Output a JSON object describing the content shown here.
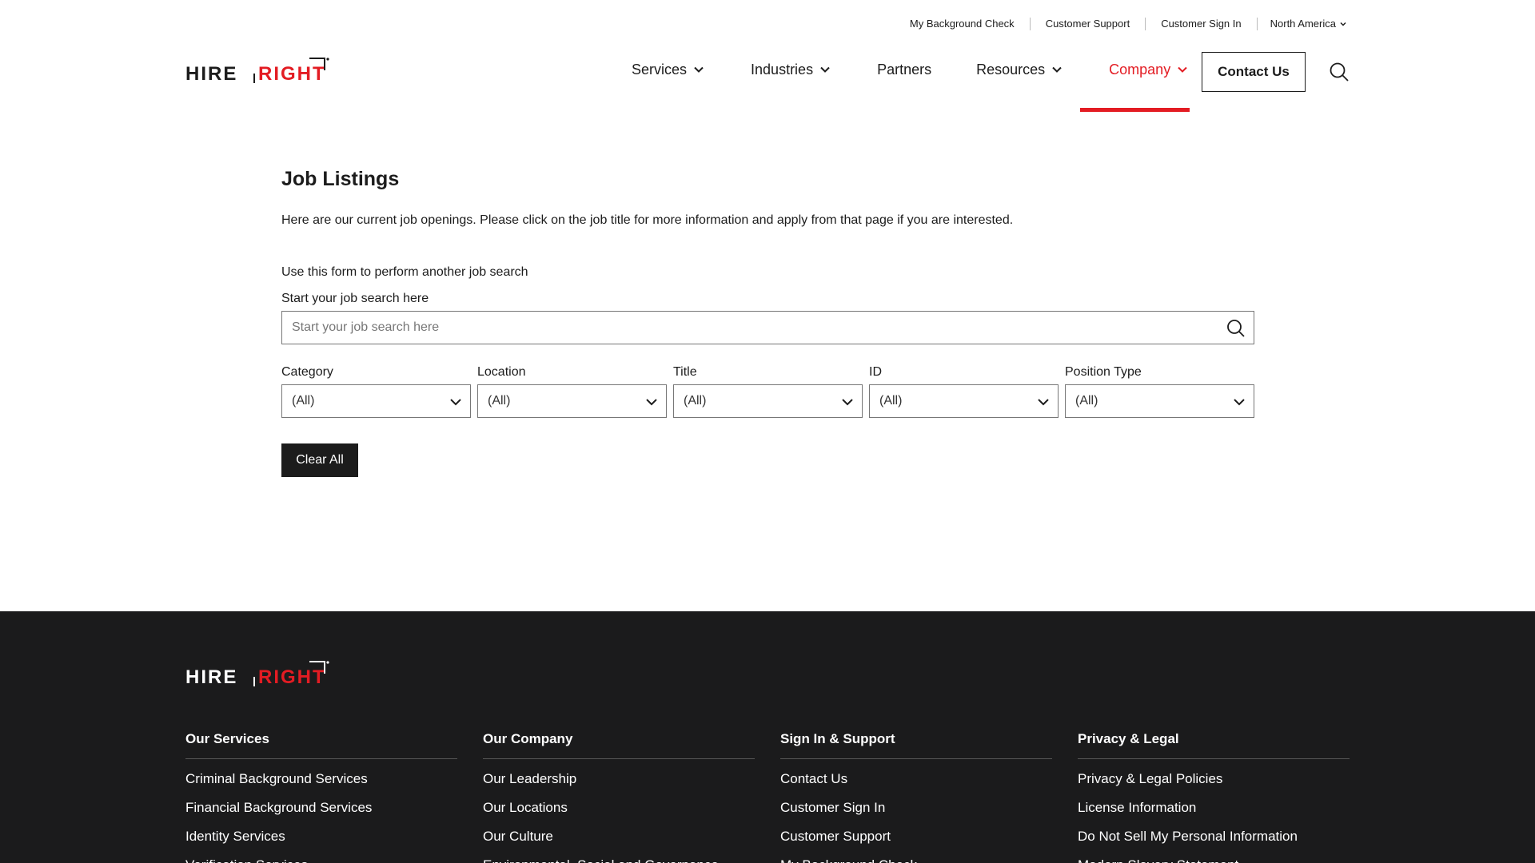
{
  "utility": {
    "links": [
      "My Background Check",
      "Customer Support",
      "Customer Sign In"
    ],
    "region": "North America"
  },
  "brand": {
    "logo_text_left": "HIRE",
    "logo_text_right": "RIGHT",
    "accent_color": "#e31c23"
  },
  "nav": {
    "items": [
      {
        "label": "Services"
      },
      {
        "label": "Industries"
      },
      {
        "label": "Partners"
      },
      {
        "label": "Resources"
      },
      {
        "label": "Company"
      }
    ],
    "contact_label": "Contact Us"
  },
  "main": {
    "title": "Job Listings",
    "intro": "Here are our current job openings. Please click on the job title for more information and apply from that page if you are interested.",
    "form_intro": "Use this form to perform another job search",
    "search_label": "Start your job search here",
    "search_placeholder": "Start your job search here",
    "filters": [
      {
        "label": "Category",
        "value": "(All)"
      },
      {
        "label": "Location",
        "value": "(All)"
      },
      {
        "label": "Title",
        "value": "(All)"
      },
      {
        "label": "ID",
        "value": "(All)"
      },
      {
        "label": "Position Type",
        "value": "(All)"
      }
    ],
    "clear_label": "Clear All"
  },
  "footer": {
    "columns": [
      {
        "heading": "Our Services",
        "links": [
          "Criminal Background Services",
          "Financial Background Services",
          "Identity Services",
          "Verification Services"
        ]
      },
      {
        "heading": "Our Company",
        "links": [
          "Our Leadership",
          "Our Locations",
          "Our Culture",
          "Environmental, Social and Governance"
        ]
      },
      {
        "heading": "Sign In & Support",
        "links": [
          "Contact Us",
          "Customer Sign In",
          "Customer Support",
          "My Background Check"
        ]
      },
      {
        "heading": "Privacy & Legal",
        "links": [
          "Privacy & Legal Policies",
          "License Information",
          "Do Not Sell My Personal Information",
          "Modern Slavery Statement"
        ]
      }
    ]
  }
}
